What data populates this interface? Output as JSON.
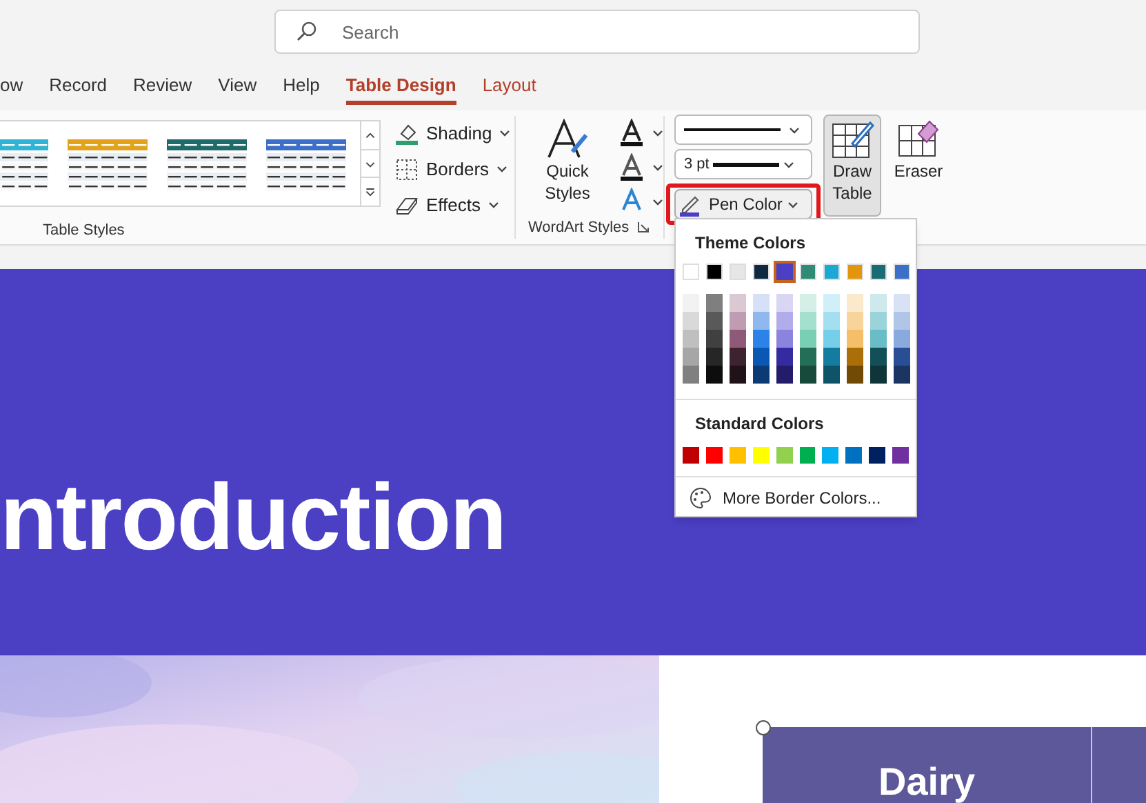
{
  "search": {
    "placeholder": "Search"
  },
  "tabs": [
    {
      "label": "ow",
      "selected": false,
      "kind": "normal"
    },
    {
      "label": "Record",
      "selected": false,
      "kind": "normal"
    },
    {
      "label": "Review",
      "selected": false,
      "kind": "normal"
    },
    {
      "label": "View",
      "selected": false,
      "kind": "normal"
    },
    {
      "label": "Help",
      "selected": false,
      "kind": "normal"
    },
    {
      "label": "Table Design",
      "selected": true,
      "kind": "contextual"
    },
    {
      "label": "Layout",
      "selected": false,
      "kind": "contextual"
    }
  ],
  "table_styles": {
    "label": "Table Styles",
    "styles": [
      {
        "color": "#2fb3d6"
      },
      {
        "color": "#e3a21a"
      },
      {
        "color": "#1f6b6b"
      },
      {
        "color": "#3c6fc7"
      }
    ],
    "commands": [
      {
        "label": "Shading",
        "kind": "shading"
      },
      {
        "label": "Borders",
        "kind": "borders"
      },
      {
        "label": "Effects",
        "kind": "effects"
      }
    ]
  },
  "wordart": {
    "label": "WordArt Styles",
    "quick_styles": "Quick Styles"
  },
  "draw_borders": {
    "line_weight": "3 pt",
    "pen_color": "Pen Color",
    "draw_table": {
      "label": "Draw Table",
      "selected": true
    },
    "eraser": {
      "label": "Eraser",
      "selected": false
    }
  },
  "pen_color_menu": {
    "theme_title": "Theme Colors",
    "theme_colors": [
      {
        "color": "#ffffff",
        "selected": false,
        "shades": [
          {
            "color": "#f2f2f2"
          },
          {
            "color": "#d9d9d9"
          },
          {
            "color": "#bfbfbf"
          },
          {
            "color": "#a6a6a6"
          },
          {
            "color": "#808080"
          }
        ]
      },
      {
        "color": "#000000",
        "selected": false,
        "shades": [
          {
            "color": "#7f7f7f"
          },
          {
            "color": "#595959"
          },
          {
            "color": "#404040"
          },
          {
            "color": "#262626"
          },
          {
            "color": "#0d0d0d"
          }
        ]
      },
      {
        "color": "#e7e6e6",
        "selected": false,
        "shades": [
          {
            "color": "#dac9d3"
          },
          {
            "color": "#c09cb3"
          },
          {
            "color": "#8f5a79"
          },
          {
            "color": "#3d2230"
          },
          {
            "color": "#1f1218"
          }
        ]
      },
      {
        "color": "#0e2841",
        "selected": false,
        "shades": [
          {
            "color": "#d6e0f6"
          },
          {
            "color": "#8fb8ee"
          },
          {
            "color": "#2d82e8"
          },
          {
            "color": "#0b58b4"
          },
          {
            "color": "#0b3a74"
          }
        ]
      },
      {
        "color": "#4b3fc4",
        "selected": true,
        "shades": [
          {
            "color": "#d8d6f3"
          },
          {
            "color": "#b1adea"
          },
          {
            "color": "#8a84de"
          },
          {
            "color": "#352ba0"
          },
          {
            "color": "#231c6b"
          }
        ]
      },
      {
        "color": "#2e8b75",
        "selected": false,
        "shades": [
          {
            "color": "#d3efe6"
          },
          {
            "color": "#a5dfcd"
          },
          {
            "color": "#79cfb3"
          },
          {
            "color": "#236e57"
          },
          {
            "color": "#174a3a"
          }
        ]
      },
      {
        "color": "#1ba8d4",
        "selected": false,
        "shades": [
          {
            "color": "#d1eff8"
          },
          {
            "color": "#a4dff1"
          },
          {
            "color": "#76cfea"
          },
          {
            "color": "#147d9f"
          },
          {
            "color": "#0e536a"
          }
        ]
      },
      {
        "color": "#e3950d",
        "selected": false,
        "shades": [
          {
            "color": "#fbe9cc"
          },
          {
            "color": "#f8d49a"
          },
          {
            "color": "#f4bf68"
          },
          {
            "color": "#aa6f09"
          },
          {
            "color": "#714a06"
          }
        ]
      },
      {
        "color": "#196b74",
        "selected": false,
        "shades": [
          {
            "color": "#cde9ec"
          },
          {
            "color": "#9bd3da"
          },
          {
            "color": "#69bdc7"
          },
          {
            "color": "#134f57"
          },
          {
            "color": "#0d353a"
          }
        ]
      },
      {
        "color": "#3c6fc7",
        "selected": false,
        "shades": [
          {
            "color": "#d8e2f4"
          },
          {
            "color": "#b1c5e9"
          },
          {
            "color": "#8aa9dd"
          },
          {
            "color": "#284f95"
          },
          {
            "color": "#1b3563"
          }
        ]
      }
    ],
    "standard_title": "Standard Colors",
    "standard_colors": [
      {
        "color": "#c00000"
      },
      {
        "color": "#ff0000"
      },
      {
        "color": "#ffc000"
      },
      {
        "color": "#ffff00"
      },
      {
        "color": "#92d050"
      },
      {
        "color": "#00b050"
      },
      {
        "color": "#00b0f0"
      },
      {
        "color": "#0070c0"
      },
      {
        "color": "#002060"
      },
      {
        "color": "#7030a0"
      }
    ],
    "more": "More Border Colors..."
  },
  "slide": {
    "title": "ntroduction",
    "table_header": "Dairy"
  }
}
